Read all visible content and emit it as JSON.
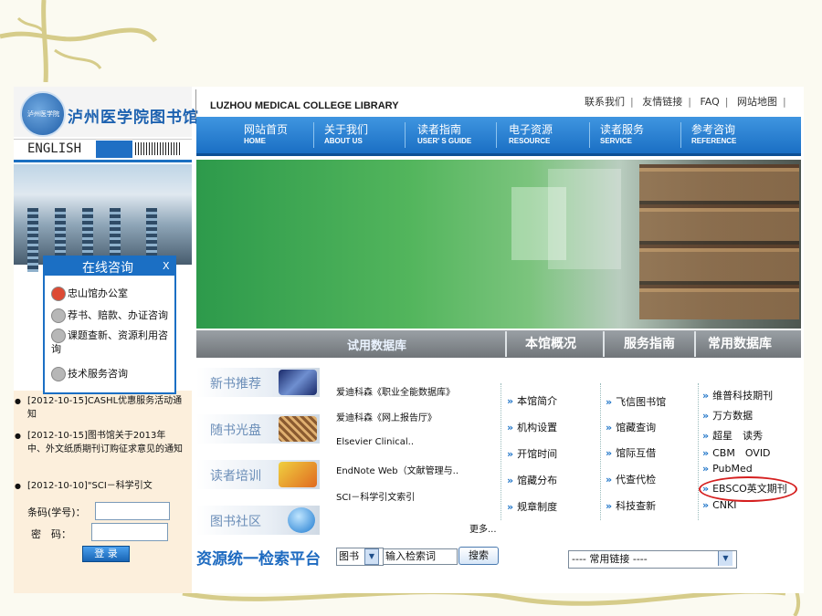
{
  "header": {
    "logo_text": "泸州医学院图书馆",
    "emblem_text": "泸州医学院",
    "english_label": "ENGLISH",
    "site_name": "LUZHOU MEDICAL COLLEGE LIBRARY",
    "top_links": [
      "联系我们",
      "友情链接",
      "FAQ",
      "网站地图"
    ]
  },
  "nav": [
    {
      "zh": "网站首页",
      "en": "HOME"
    },
    {
      "zh": "关于我们",
      "en": "ABOUT US"
    },
    {
      "zh": "读者指南",
      "en": "USER' S GUIDE"
    },
    {
      "zh": "电子资源",
      "en": "RESOURCE"
    },
    {
      "zh": "读者服务",
      "en": "SERVICE"
    },
    {
      "zh": "参考咨询",
      "en": "REFERENCE"
    }
  ],
  "banner_tabs": {
    "trial_db": "试用数据库",
    "overview": "本馆概况",
    "service_guide": "服务指南",
    "common_db": "常用数据库"
  },
  "chat": {
    "title": "在线咨询",
    "close": "X",
    "items": [
      "忠山馆办公室",
      "荐书、赔款、办证咨询",
      "课题查新、资源利用咨询",
      "技术服务咨询"
    ]
  },
  "news": [
    "[2012-10-15]CASHL优惠服务活动通知",
    "[2012-10-15]图书馆关于2013年中、外文纸质期刊订购征求意见的通知",
    "[2012-10-10]\"SCI－科学引文"
  ],
  "login": {
    "barcode_label": "条码(学号)：",
    "password_label": "密　码：",
    "button": "登 录"
  },
  "side_buttons": [
    "新书推荐",
    "随书光盘",
    "读者培训",
    "图书社区"
  ],
  "search_title": "资源统一检索平台",
  "trial_list": [
    "爱迪科森《职业全能数据库》",
    "爱迪科森《网上报告厅》",
    "Elsevier Clinical..",
    "EndNote Web（文献管理与..",
    "SCI－科学引文索引"
  ],
  "more": "更多...",
  "overview_links": [
    "本馆简介",
    "机构设置",
    "开馆时间",
    "馆藏分布",
    "规章制度"
  ],
  "service_links": [
    "飞信图书馆",
    "馆藏查询",
    "馆际互借",
    "代查代检",
    "科技查新"
  ],
  "db_links": [
    "维普科技期刊",
    "万方数据",
    "超星　读秀",
    "CBM　OVID",
    "PubMed",
    "EBSCO英文期刊",
    "CNKI"
  ],
  "search": {
    "scope": "图书",
    "keyword": "输入检索词",
    "button": "搜索",
    "common_links": "---- 常用链接 ----"
  },
  "colors": {
    "brand_blue": "#1b6fc4",
    "highlight_ring": "#d51f1f"
  }
}
